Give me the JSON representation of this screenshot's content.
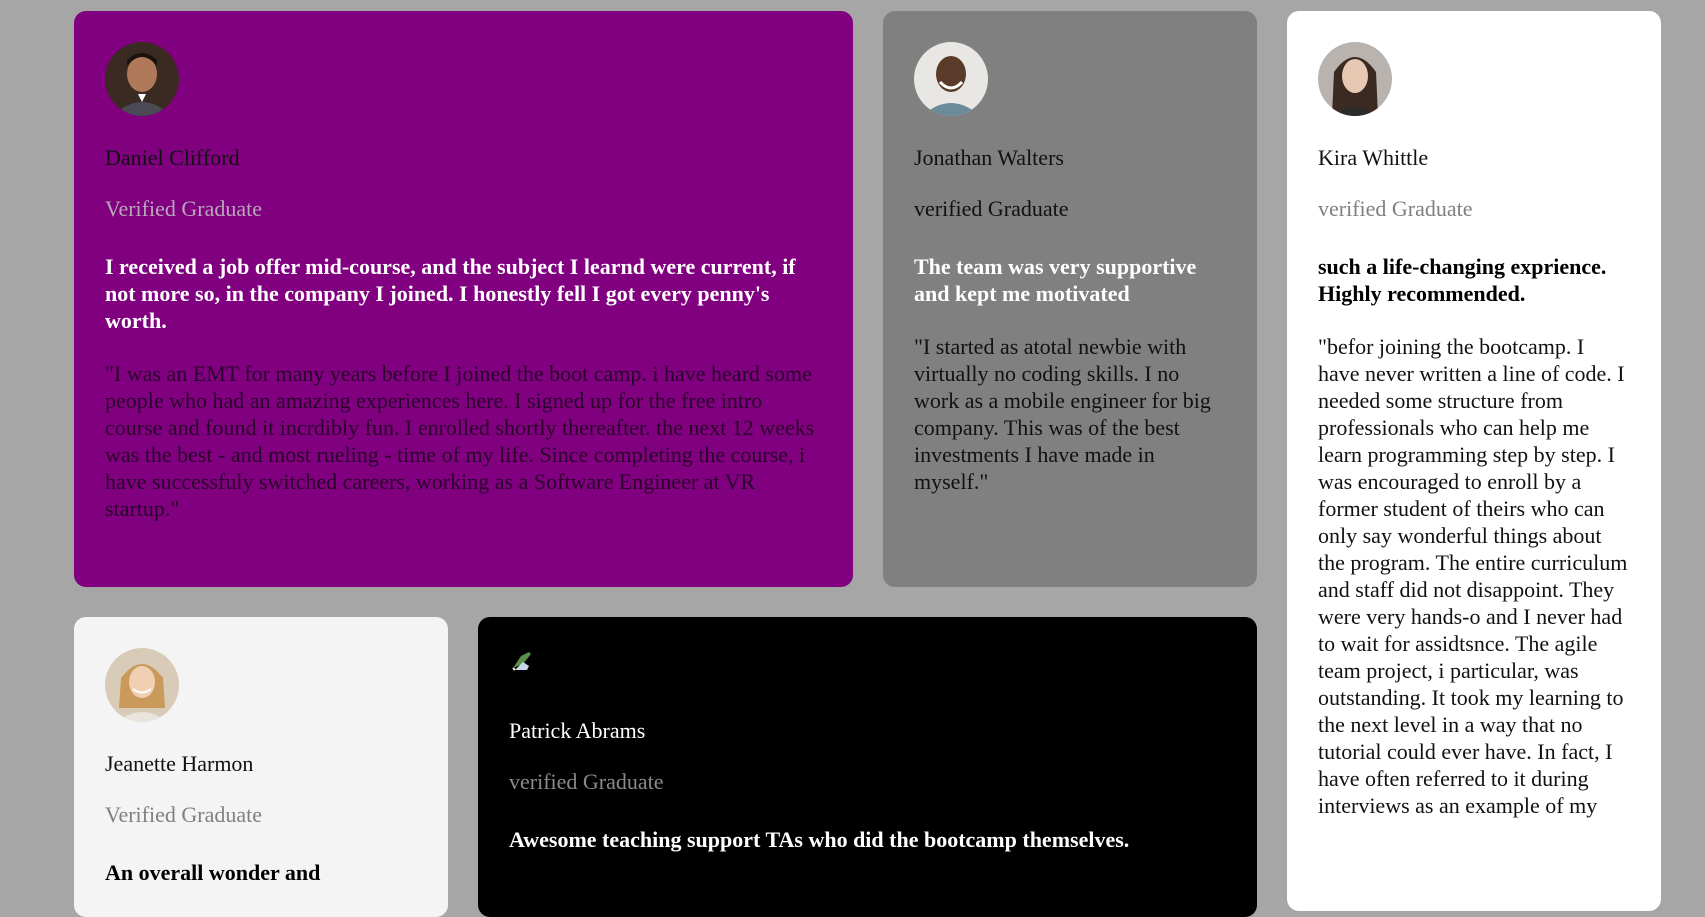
{
  "testimonials": {
    "daniel": {
      "name": "Daniel Clifford",
      "role": "Verified Graduate",
      "headline": "I received a job offer mid-course, and the subject I learnd were current, if not more so, in the company I joined. I honestly fell I got every penny's worth.",
      "quote": "\"I was an EMT for many years before I joined the boot camp. i have heard some people who had an amazing experiences here. I signed up for the free intro course and found it incrdibly fun. I enrolled shortly thereafter. the next 12 weeks was the best - and most rueling - time of my life. Since completing the course, i have successfuly switched careers, working as a Software Engineer at VR startup.\"",
      "card_color": "#800080"
    },
    "jonathan": {
      "name": "Jonathan Walters",
      "role": "verified Graduate",
      "headline": "The team was very supportive and kept me motivated",
      "quote": "\"I started as atotal newbie with virtually no coding skills. I no work as a mobile engineer for big company. This was of the best investments I have made in myself.\"",
      "card_color": "#808080"
    },
    "kira": {
      "name": "Kira Whittle",
      "role": "verified Graduate",
      "headline": "such a life-changing exprience. Highly recommended.",
      "quote": "\"befor joining the bootcamp. I have never written a line of code. I needed some structure from professionals who can help me learn programming step by step. I was encouraged to enroll by a former student of theirs who can only say wonderful things about the program. The entire curriculum and staff did not disappoint. They were very hands-o and I never had to wait for assidtsnce. The agile team project, i particular, was outstanding. It took my learning to the next level in a way that no tutorial could ever have. In fact, I have often referred to it during interviews as an example of my",
      "card_color": "#ffffff"
    },
    "jeanette": {
      "name": "Jeanette Harmon",
      "role": "Verified Graduate",
      "headline": "An overall wonder and",
      "card_color": "#f4f4f4"
    },
    "patrick": {
      "name": "Patrick Abrams",
      "role": "verified Graduate",
      "headline": "Awesome teaching support TAs who did the bootcamp themselves.",
      "card_color": "#000000",
      "avatar_icon": "broken-image-icon"
    }
  },
  "avatars": {
    "daniel": "avatar-icon",
    "jonathan": "avatar-icon",
    "kira": "avatar-icon",
    "jeanette": "avatar-icon"
  }
}
